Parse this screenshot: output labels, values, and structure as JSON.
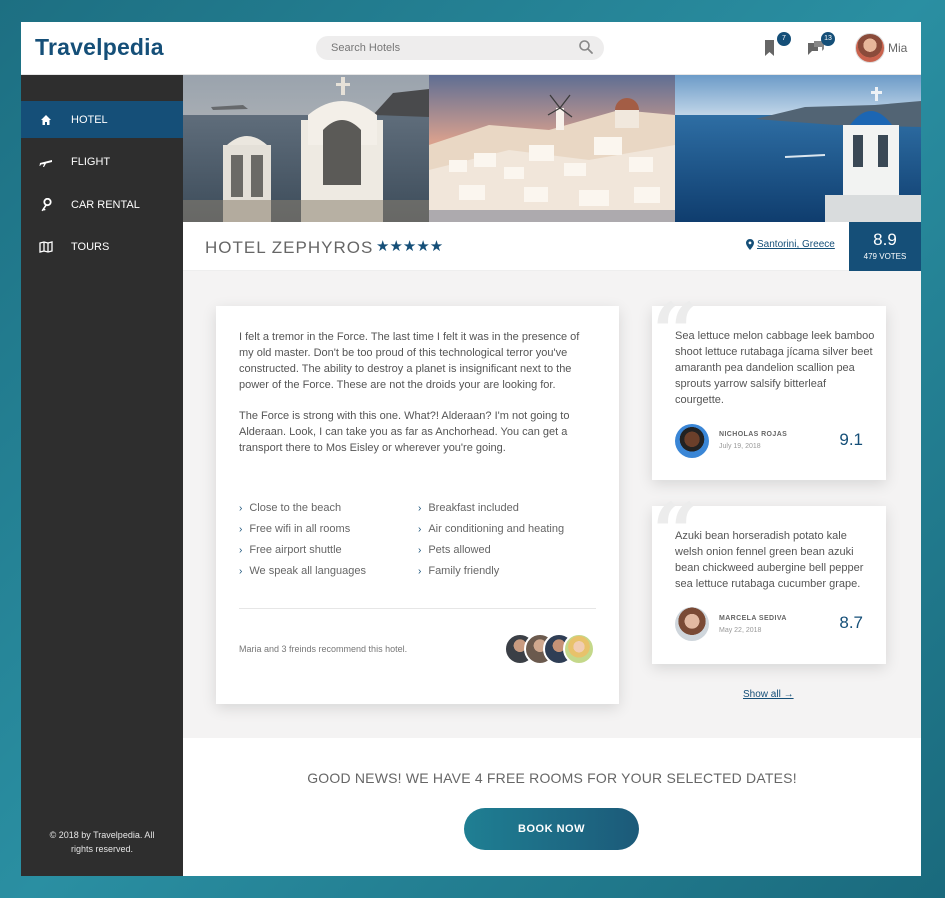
{
  "header": {
    "logo": "Travelpedia",
    "search_placeholder": "Search Hotels",
    "bookmarks_count": "7",
    "messages_count": "13",
    "user_name": "Mia"
  },
  "sidebar": {
    "items": [
      {
        "label": "HOTEL",
        "icon": "home-icon"
      },
      {
        "label": "FLIGHT",
        "icon": "airplane-icon"
      },
      {
        "label": "CAR RENTAL",
        "icon": "key-icon"
      },
      {
        "label": "TOURS",
        "icon": "map-icon"
      }
    ],
    "copyright": "© 2018 by Travelpedia. All rights reserved."
  },
  "hotel": {
    "name": "HOTEL ZEPHYROS",
    "stars": "★★★★★",
    "location": "Santorini, Greece",
    "score": "8.9",
    "votes": "479 VOTES"
  },
  "description": {
    "p1": "I felt a tremor in the Force. The last time I felt it was in the presence of my old master. Don't be too proud of this technological terror you've constructed. The ability to destroy a planet is insignificant next to the power of the Force. These are not the droids your are looking for.",
    "p2": "The Force is strong with this one. What?! Alderaan? I'm not going to Alderaan. Look, I can take you as far as Anchorhead. You can get a transport there to Mos Eisley or wherever you're going.",
    "features": [
      "Close to the beach",
      "Breakfast included",
      "Free wifi in all rooms",
      "Air conditioning and heating",
      "Free airport shuttle",
      "Pets allowed",
      "We speak all languages",
      "Family friendly"
    ],
    "recommend": "Maria and 3 freinds recommend this hotel."
  },
  "reviews": [
    {
      "text": "Sea lettuce melon cabbage leek bamboo shoot lettuce rutabaga jícama silver beet amaranth pea dandelion scallion pea sprouts yarrow salsify bitterleaf courgette.",
      "name": "NICHOLAS ROJAS",
      "date": "July 19, 2018",
      "score": "9.1"
    },
    {
      "text": "Azuki bean horseradish potato kale welsh onion fennel green bean azuki bean chickweed aubergine bell pepper sea lettuce rutabaga cucumber grape.",
      "name": "MARCELA SEDIVA",
      "date": "May 22, 2018",
      "score": "8.7"
    }
  ],
  "show_all": "Show all →",
  "availability": {
    "message": "GOOD NEWS! WE HAVE 4 FREE ROOMS FOR YOUR SELECTED DATES!",
    "button": "BOOK NOW"
  },
  "colors": {
    "accent": "#154f78",
    "sidebar": "#2e2e2e",
    "page_background": "#1d6f82"
  }
}
